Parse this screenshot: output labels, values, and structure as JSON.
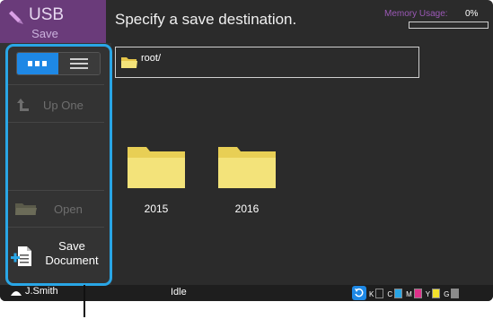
{
  "app": {
    "name": "USB",
    "subtitle": "Save"
  },
  "header": {
    "title": "Specify a save destination.",
    "memory_label": "Memory Usage:",
    "memory_value": "0%",
    "memory_fraction": 0
  },
  "path": {
    "current": "root/"
  },
  "sidebar": {
    "up_one_label": "Up One",
    "open_label": "Open",
    "save_document_label_line1": "Save",
    "save_document_label_line2": "Document"
  },
  "folders": [
    {
      "name": "2015"
    },
    {
      "name": "2016"
    }
  ],
  "status_bar": {
    "user": "J.Smith",
    "status": "Idle",
    "toner": [
      {
        "label": "K",
        "color": "#444444",
        "level": 0
      },
      {
        "label": "C",
        "color": "#29a6e6",
        "level": 1
      },
      {
        "label": "M",
        "color": "#e0318b",
        "level": 1
      },
      {
        "label": "Y",
        "color": "#f2e12b",
        "level": 1
      },
      {
        "label": "G",
        "color": "#8c8c8c",
        "level": 1
      }
    ]
  },
  "colors": {
    "accent": "#1e88e5",
    "highlight": "#29a6e6",
    "app_tile": "#6a3b7a",
    "folder_yellow": "#f3e37a"
  }
}
